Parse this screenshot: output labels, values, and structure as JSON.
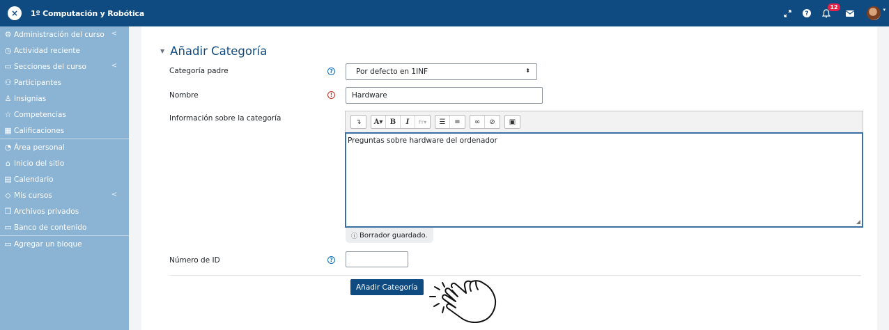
{
  "navbar": {
    "toggle_icon": "close-icon",
    "site_name": "1º Computación y Robótica",
    "notification_count": "12",
    "icons": [
      "expand-icon",
      "help-icon",
      "bell-icon",
      "mail-icon",
      "avatar"
    ]
  },
  "sidebar": {
    "groups": [
      {
        "items": [
          {
            "label": "Administración del curso",
            "icon": "gears-icon",
            "chevron": "<"
          },
          {
            "label": "Actividad reciente",
            "icon": "clock-icon"
          },
          {
            "label": "Secciones del curso",
            "icon": "folder-icon",
            "chevron": "<"
          },
          {
            "label": "Participantes",
            "icon": "users-icon"
          },
          {
            "label": "Insignias",
            "icon": "badge-icon"
          },
          {
            "label": "Competencias",
            "icon": "star-icon"
          },
          {
            "label": "Calificaciones",
            "icon": "table-icon"
          }
        ]
      },
      {
        "items": [
          {
            "label": "Área personal",
            "icon": "dashboard-icon"
          },
          {
            "label": "Inicio del sitio",
            "icon": "home-icon"
          },
          {
            "label": "Calendario",
            "icon": "calendar-icon"
          },
          {
            "label": "Mis cursos",
            "icon": "graduation-cap-icon",
            "chevron": "<"
          },
          {
            "label": "Archivos privados",
            "icon": "files-icon"
          },
          {
            "label": "Banco de contenido",
            "icon": "folder-icon"
          }
        ]
      },
      {
        "items": [
          {
            "label": "Agregar un bloque",
            "icon": "folder-icon"
          }
        ]
      }
    ]
  },
  "form": {
    "title": "Añadir Categoría",
    "parent": {
      "label": "Categoría padre",
      "value": "Por defecto en 1INF"
    },
    "name": {
      "label": "Nombre",
      "value": "Hardware"
    },
    "info": {
      "label": "Información sobre la categoría",
      "content": "Preguntas sobre hardware del ordenador",
      "draft_status": "Borrador guardado."
    },
    "id_number": {
      "label": "Número de ID",
      "value": ""
    },
    "submit_label": "Añadir Categoría"
  },
  "toolbar": {
    "buttons": [
      "collapse-icon",
      "font-style-icon",
      "bold-icon",
      "italic-icon",
      "font-color-icon",
      "unordered-list-icon",
      "ordered-list-icon",
      "link-icon",
      "unlink-icon",
      "image-icon"
    ]
  },
  "colors": {
    "navbar": "#0f4b81",
    "sidebar": "#8bb3d4",
    "accent": "#0f4b81",
    "required": "#ca3120",
    "help": "#0f6cbf"
  }
}
